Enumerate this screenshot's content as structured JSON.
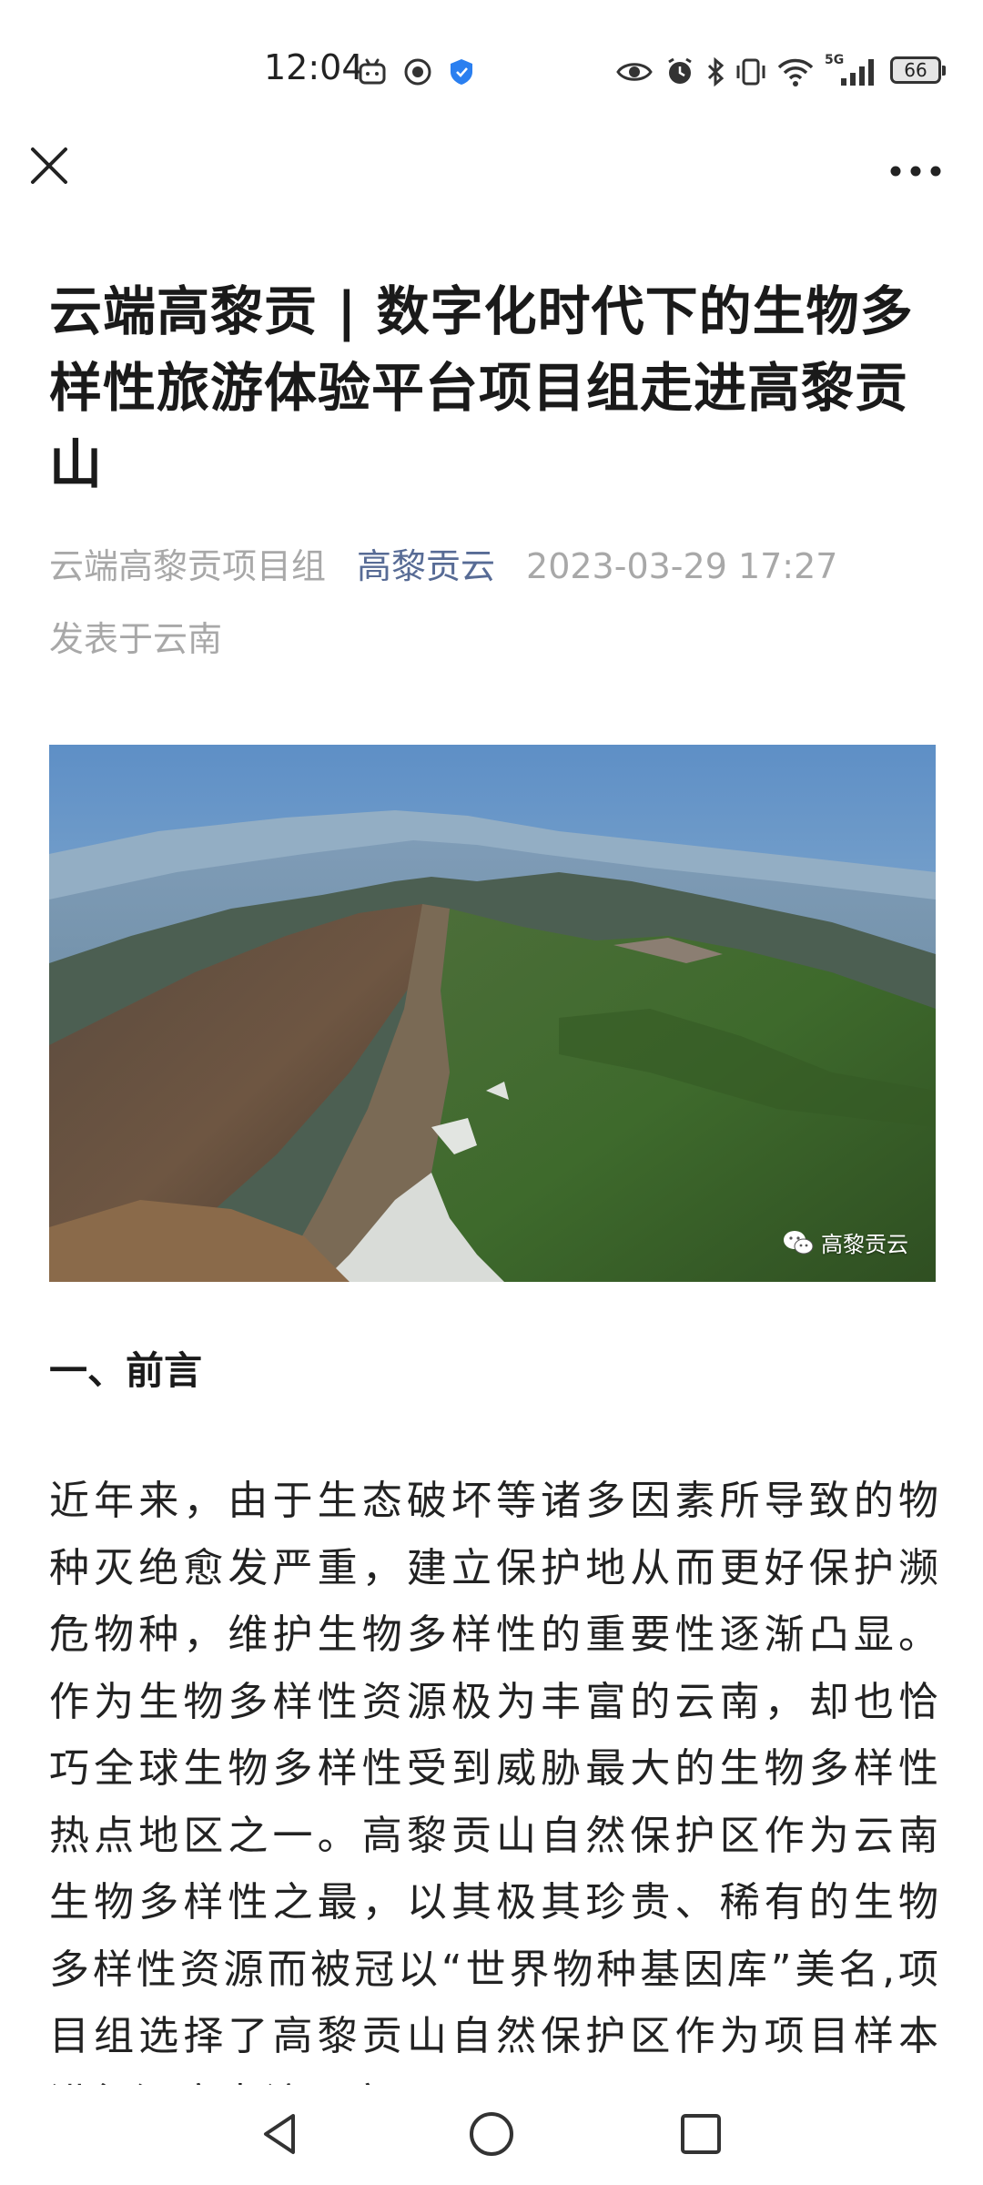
{
  "status_bar": {
    "time": "12:04",
    "battery_level": "66",
    "left_icons": [
      "bilibili-icon",
      "timer-icon",
      "shield-icon"
    ],
    "right_icons": [
      "eye-icon",
      "alarm-icon",
      "bluetooth-icon",
      "vibrate-icon",
      "wifi-icon",
      "signal-5g-icon",
      "battery-icon"
    ],
    "network_label": "5G"
  },
  "nav": {
    "close_icon": "close-icon",
    "more_icon": "more-horizontal-icon"
  },
  "article": {
    "title": "云端高黎贡 | 数字化时代下的生物多样性旅游体验平台项目组走进高黎贡山",
    "author": "云端高黎贡项目组",
    "account": "高黎贡云",
    "datetime": "2023-03-29 17:27",
    "location": "发表于云南",
    "image_watermark": "高黎贡云",
    "section_heading": "一、前言",
    "body": "近年来，由于生态破坏等诸多因素所导致的物种灭绝愈发严重，建立保护地从而更好保护濒危物种，维护生物多样性的重要性逐渐凸显。作为生物多样性资源极为丰富的云南，却也恰巧全球生物多样性受到威胁最大的生物多样性热点地区之一。高黎贡山自然保护区作为云南生物多样性之最，以其极其珍贵、稀有的生物多样性资源而被冠以“世界物种基因库”美名,项目组选择了高黎贡山自然保护区作为项目样本进行深度走访研究，"
  },
  "bottom_nav": {
    "icons": [
      "back-triangle-icon",
      "home-circle-icon",
      "recents-square-icon"
    ]
  },
  "colors": {
    "link": "#576b95",
    "meta_gray": "#a8a8a8",
    "text": "#1a1a1a"
  }
}
